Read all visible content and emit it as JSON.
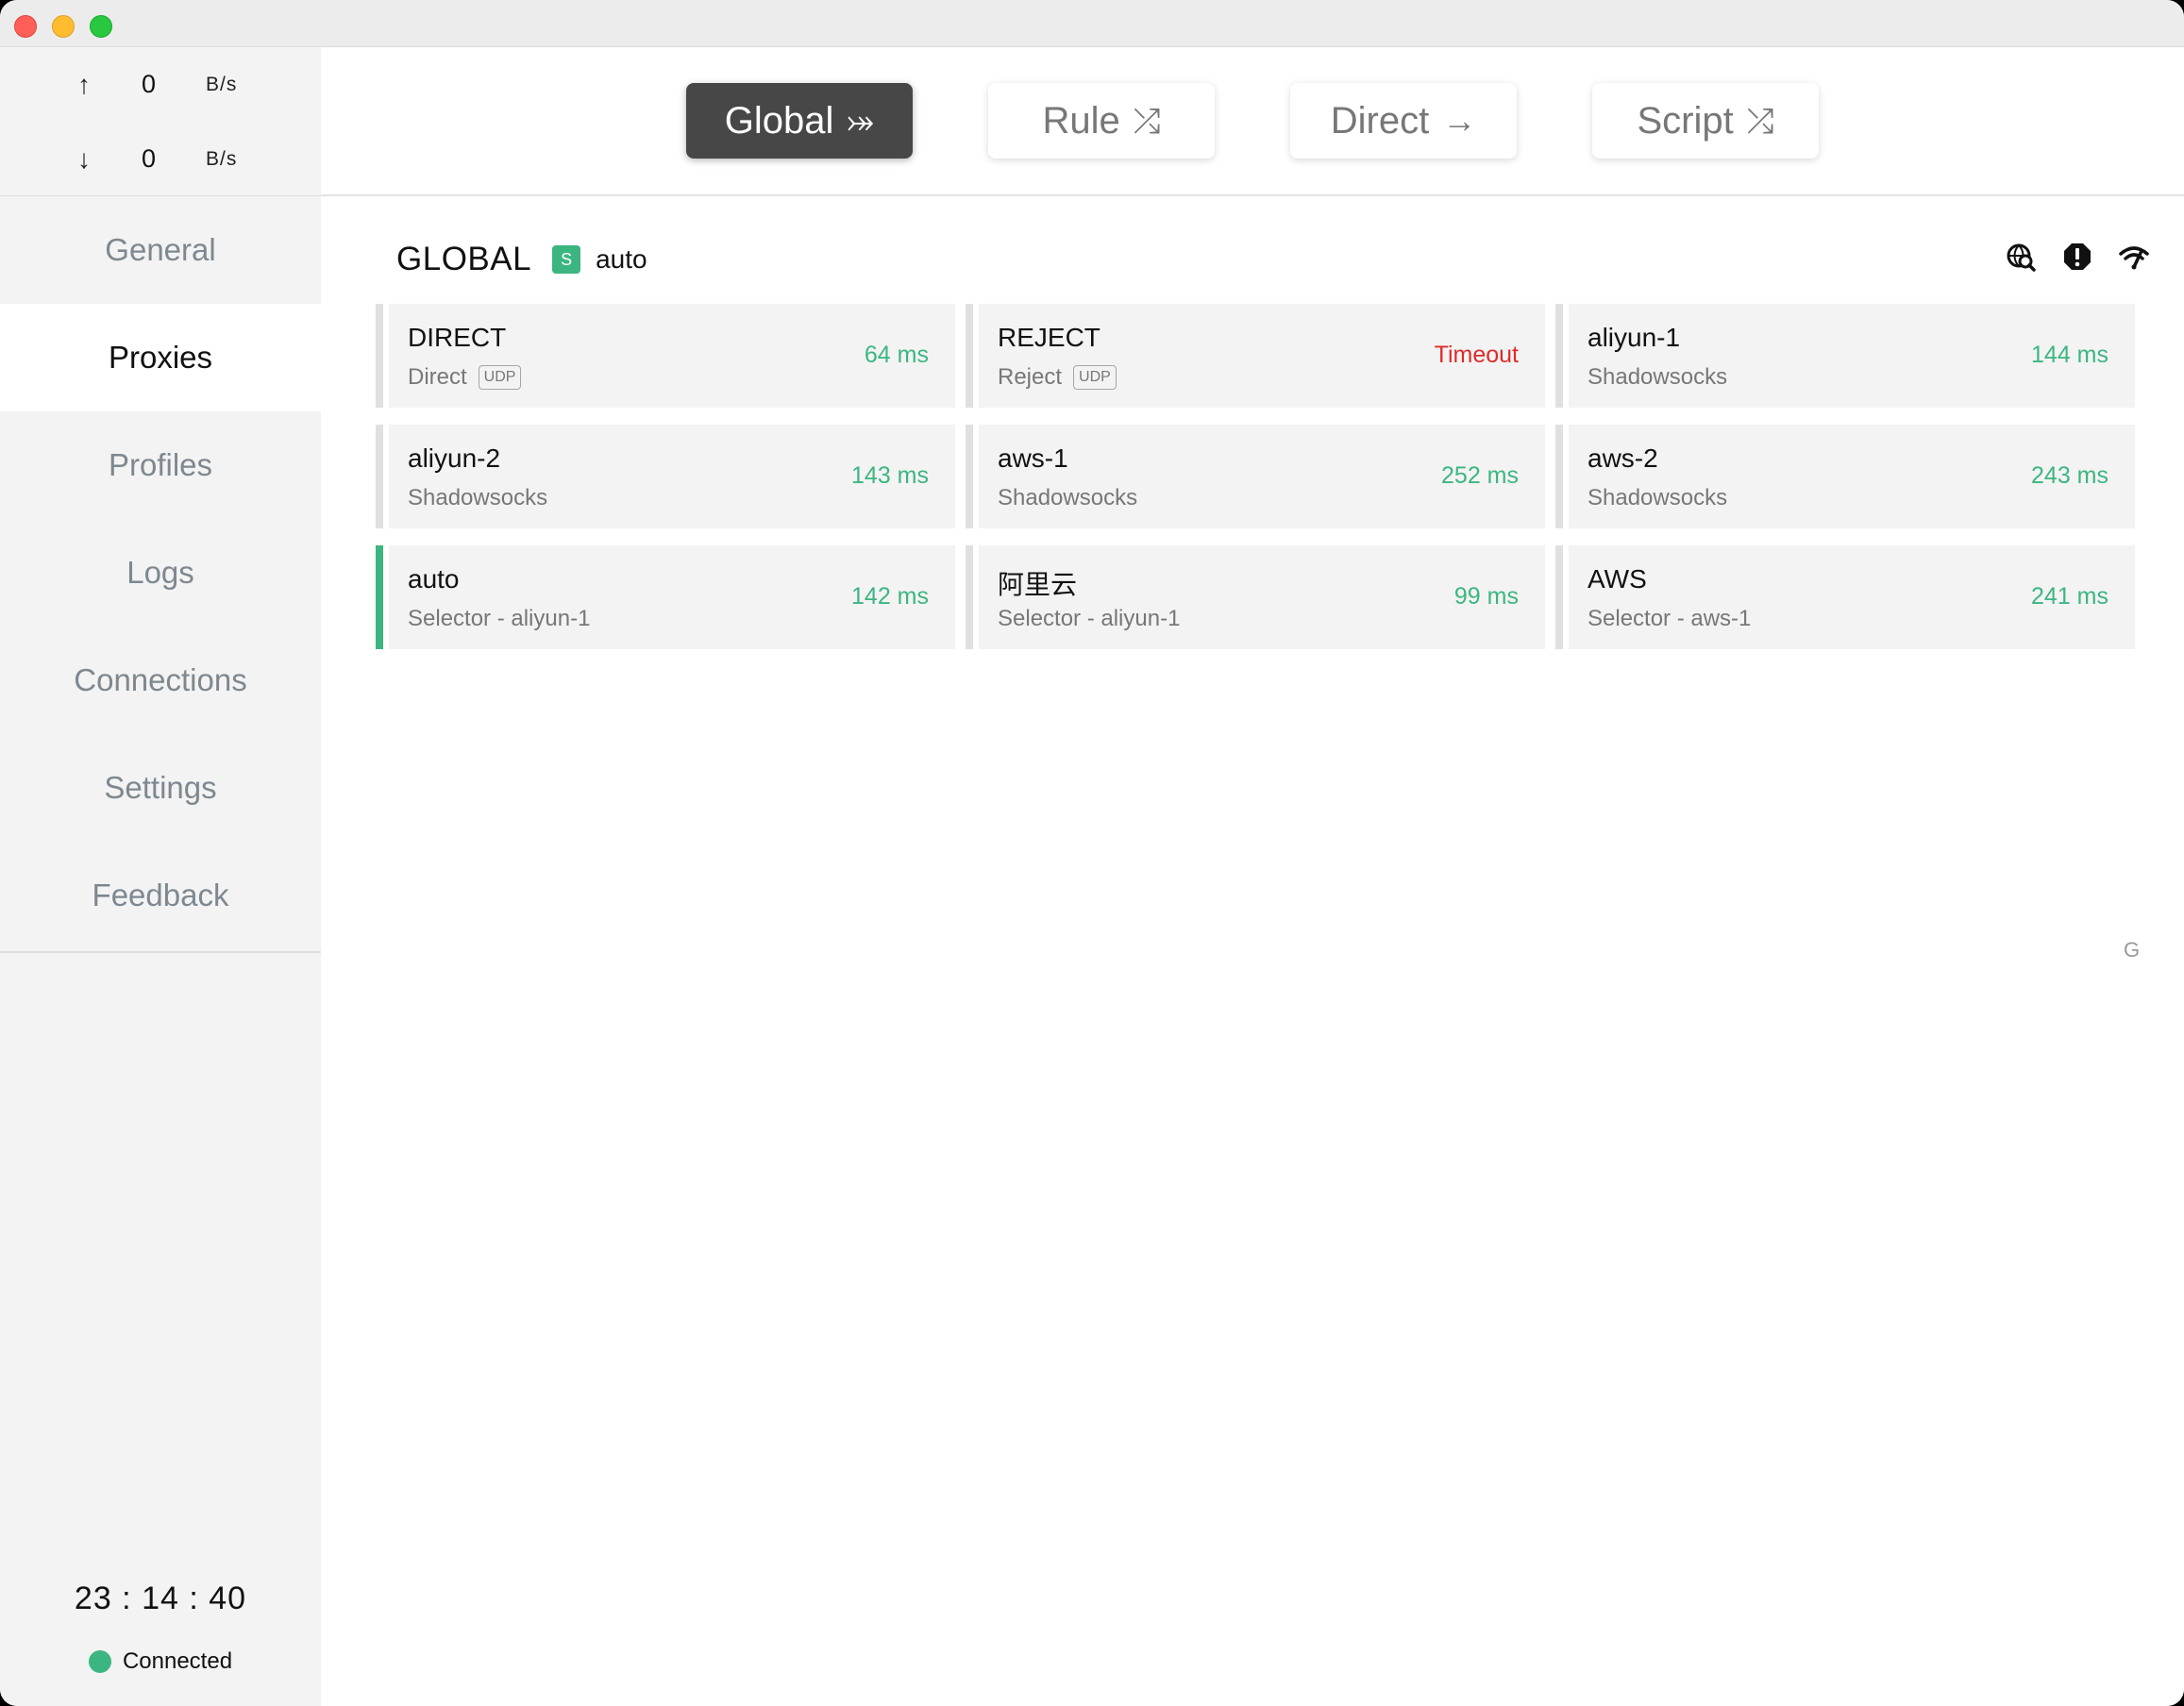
{
  "traffic": {
    "up_arrow": "↑",
    "up_value": "0",
    "up_unit": "B/s",
    "down_arrow": "↓",
    "down_value": "0",
    "down_unit": "B/s"
  },
  "nav": {
    "items": [
      {
        "label": "General"
      },
      {
        "label": "Proxies"
      },
      {
        "label": "Profiles"
      },
      {
        "label": "Logs"
      },
      {
        "label": "Connections"
      },
      {
        "label": "Settings"
      },
      {
        "label": "Feedback"
      }
    ],
    "active": "Proxies"
  },
  "status": {
    "clock": "23 : 14 : 40",
    "connection": "Connected"
  },
  "modes": [
    {
      "label": "Global",
      "glyph": "⤖",
      "active": true
    },
    {
      "label": "Rule",
      "glyph": "⤮",
      "active": false
    },
    {
      "label": "Direct",
      "glyph": "→",
      "active": false
    },
    {
      "label": "Script",
      "glyph": "⤮",
      "active": false
    }
  ],
  "group": {
    "name": "GLOBAL",
    "badge": "S",
    "selected": "auto"
  },
  "icons": [
    "search-globe-icon",
    "alert-icon",
    "wifi-speed-icon"
  ],
  "proxies": [
    {
      "name": "DIRECT",
      "type": "Direct",
      "udp": "UDP",
      "delay": "64 ms"
    },
    {
      "name": "REJECT",
      "type": "Reject",
      "udp": "UDP",
      "delay": "Timeout"
    },
    {
      "name": "aliyun-1",
      "type": "Shadowsocks",
      "udp": "",
      "delay": "144 ms"
    },
    {
      "name": "aliyun-2",
      "type": "Shadowsocks",
      "udp": "",
      "delay": "143 ms"
    },
    {
      "name": "aws-1",
      "type": "Shadowsocks",
      "udp": "",
      "delay": "252 ms"
    },
    {
      "name": "aws-2",
      "type": "Shadowsocks",
      "udp": "",
      "delay": "243 ms"
    },
    {
      "name": "auto",
      "type": "Selector - aliyun-1",
      "udp": "",
      "delay": "142 ms"
    },
    {
      "name": "阿里云",
      "type": "Selector - aliyun-1",
      "udp": "",
      "delay": "99 ms"
    },
    {
      "name": "AWS",
      "type": "Selector - aws-1",
      "udp": "",
      "delay": "241 ms"
    }
  ],
  "edge_letter": "G",
  "colors": {
    "accent": "#3cb680",
    "timeout": "#e02a2a",
    "active_mode": "#474747"
  }
}
